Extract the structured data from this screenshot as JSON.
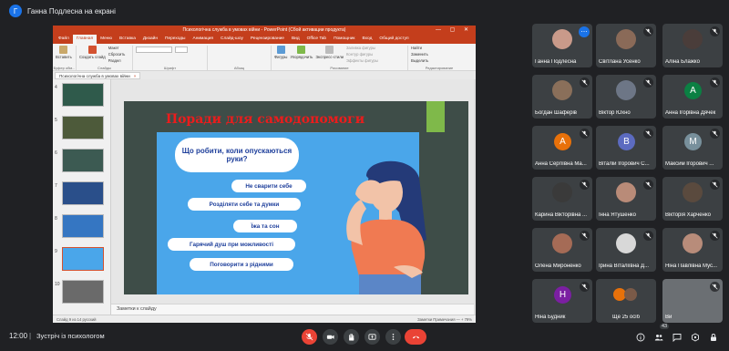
{
  "meet": {
    "presenter_initial": "Г",
    "presenter_text": "Ганна Подлесна на екрані",
    "time": "12:00",
    "separator": "|",
    "meeting_name": "Зустріч із психологом",
    "participants_count": "43"
  },
  "ppt": {
    "window_title": "Психологічна служба в умовах війни - PowerPoint (Сбой активации продукта)",
    "window_controls": "— ▢ ✕",
    "tabs": [
      "Файл",
      "Главная",
      "Меню",
      "Вставка",
      "Дизайн",
      "Переходы",
      "Анимация",
      "Слайд-шоу",
      "Рецензирование",
      "Вид",
      "Office Tab",
      "Помощник",
      "Вход",
      "Общий доступ"
    ],
    "ribbon": {
      "paste": "Вставить",
      "new_slide": "Создать слайд",
      "layout": "Макет",
      "reset": "Сбросить",
      "section": "Раздел",
      "clipboard": "Буфер обм...",
      "slides": "Слайды",
      "font": "Шрифт",
      "paragraph": "Абзац",
      "shapes": "Фигуры",
      "arrange": "Упорядочить",
      "quick_styles": "Экспресс-стили",
      "fill": "Заливка фигуры",
      "outline": "Контур фигуры",
      "effects": "Эффекты фигуры",
      "drawing": "Рисование",
      "find": "Найти",
      "replace": "Заменить",
      "select": "Выделить",
      "editing": "Редактирование"
    },
    "doc_tab": "Психологічна служба в умовах війни",
    "slide_numbers": [
      "4",
      "5",
      "6",
      "7",
      "8",
      "9",
      "10"
    ],
    "selected_slide": "9",
    "notes_placeholder": "Заметки к слайду",
    "status_left": "Слайд 9 из 14   русский",
    "status_right": "Заметки   Примечания   — + 79%"
  },
  "slide": {
    "title": "Поради для самодопомоги",
    "question": "Що робити, коли опускаються руки?",
    "tips": [
      "Не сварити себе",
      "Розділяти себе та думки",
      "Їжа та сон",
      "Гарячий душ при можливості",
      "Поговорити з рідними"
    ]
  },
  "participants": [
    {
      "name": "Ганна Подлесна",
      "type": "photo",
      "color": "#c99a8a"
    },
    {
      "name": "Світлана Усенко",
      "type": "photo",
      "color": "#8a6a58"
    },
    {
      "name": "Аліна Блажко",
      "type": "photo",
      "color": "#4a3d3a"
    },
    {
      "name": "Богдан Шаферів",
      "type": "photo",
      "color": "#8a6f5a"
    },
    {
      "name": "Віктор Юхно",
      "type": "photo",
      "color": "#6d7686"
    },
    {
      "name": "Анна Ігорівна Дячек",
      "type": "letter",
      "letter": "А",
      "color": "#0b8043"
    },
    {
      "name": "Анна Сергіївна Ма...",
      "type": "letter",
      "letter": "А",
      "color": "#e8710a"
    },
    {
      "name": "Віталій Ігорович С...",
      "type": "letter",
      "letter": "В",
      "color": "#5c6bc0"
    },
    {
      "name": "Максим Ігорович ...",
      "type": "letter",
      "letter": "М",
      "color": "#78909c"
    },
    {
      "name": "Карина Вікторівна ...",
      "type": "photo",
      "color": "#3a3a3a"
    },
    {
      "name": "Інна Ятушенко",
      "type": "photo",
      "color": "#b98b78"
    },
    {
      "name": "Вікторія Харченко",
      "type": "photo",
      "color": "#5a4a3e"
    },
    {
      "name": "Олена Мироненко",
      "type": "photo",
      "color": "#a56b56"
    },
    {
      "name": "Ірина Віталіївна Д...",
      "type": "photo",
      "color": "#d8d8d8"
    },
    {
      "name": "Ніна Павлівна Мус...",
      "type": "photo",
      "color": "#b88c7a"
    },
    {
      "name": "Ніна Будник",
      "type": "letter",
      "letter": "Н",
      "color": "#7b1fa2"
    },
    {
      "name": "Ще 25 осіб",
      "type": "more",
      "color": "#e8710a"
    },
    {
      "name": "Ви",
      "type": "self",
      "color": "#8a8f96"
    }
  ],
  "colors": {
    "accent_red": "#ea4335",
    "ppt_orange": "#c43e1c",
    "slide_bg": "#3e4d48",
    "card_blue": "#4aa6ea"
  }
}
